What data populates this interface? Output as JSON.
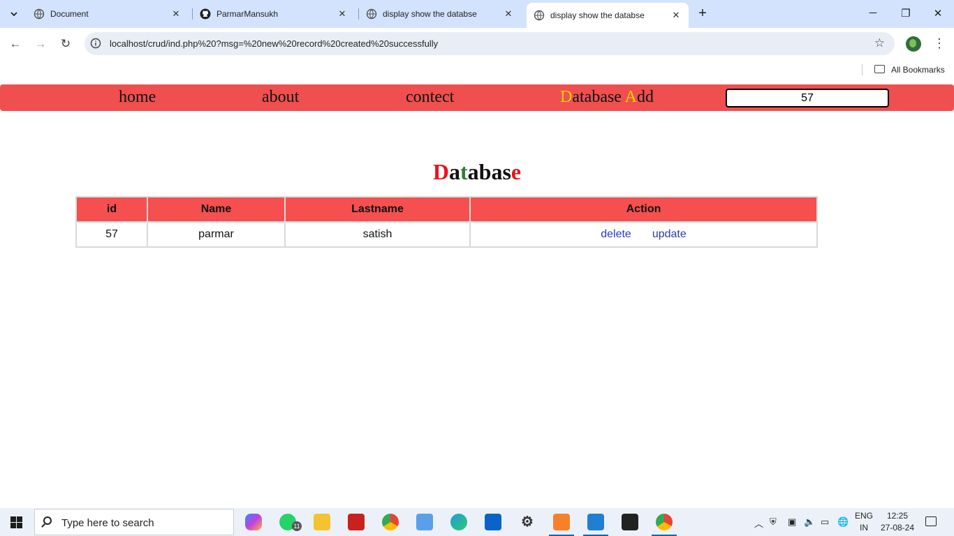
{
  "browser": {
    "tabs": [
      {
        "title": "Document",
        "favicon": "globe-icon",
        "active": false
      },
      {
        "title": "ParmarMansukh",
        "favicon": "github-icon",
        "active": false
      },
      {
        "title": "display show the databse",
        "favicon": "globe-icon",
        "active": false
      },
      {
        "title": "display show the databse",
        "favicon": "globe-icon",
        "active": true
      }
    ],
    "url": "localhost/crud/ind.php%20?msg=%20new%20record%20created%20successfully",
    "bookmarks_label": "All Bookmarks"
  },
  "page": {
    "nav": {
      "home": "home",
      "about": "about",
      "contect": "contect",
      "add_first": "D",
      "add_mid": "atabase ",
      "add_second": "A",
      "add_rest": "dd",
      "search_value": "57"
    },
    "heading": {
      "p1": "D",
      "p2": "a",
      "p3": "t",
      "p4": "abas",
      "p5": "e"
    },
    "table": {
      "headers": [
        "id",
        "Name",
        "Lastname",
        "Action"
      ],
      "rows": [
        {
          "id": "57",
          "name": "parmar",
          "lastname": "satish",
          "delete": "delete",
          "update": "update"
        }
      ]
    },
    "colors": {
      "navbar": "#ef4f4f",
      "table_header": "#f54f4f",
      "accent_yellow": "#ffd500",
      "heading_red": "#e8141a",
      "heading_green": "#2e7d32",
      "link": "#2c3ab8"
    }
  },
  "taskbar": {
    "search_placeholder": "Type here to search",
    "whatsapp_badge": "11",
    "lang_line1": "ENG",
    "lang_line2": "IN",
    "time": "12:25",
    "date": "27-08-24"
  }
}
